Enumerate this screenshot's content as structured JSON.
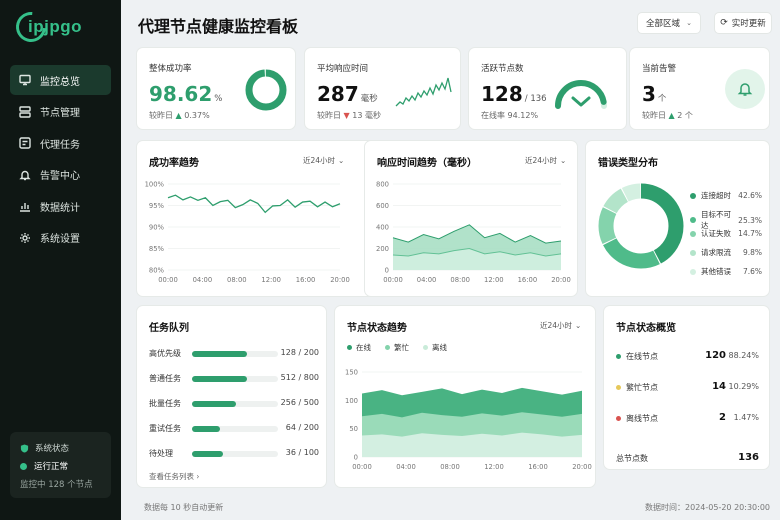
{
  "brand": {
    "logo_text": "ipjpgo"
  },
  "sidebar": {
    "items": [
      {
        "label": "监控总览",
        "icon": "monitor-icon",
        "active": true
      },
      {
        "label": "节点管理",
        "icon": "nodes-icon"
      },
      {
        "label": "代理任务",
        "icon": "task-icon"
      },
      {
        "label": "告警中心",
        "icon": "bell-icon"
      },
      {
        "label": "数据统计",
        "icon": "stats-icon"
      },
      {
        "label": "系统设置",
        "icon": "gear-icon"
      }
    ],
    "status": {
      "title": "系统状态",
      "state": "运行正常",
      "monitoring": "监控中 128 个节点"
    }
  },
  "header": {
    "title": "代理节点健康监控看板",
    "region": "全部区域",
    "refresh": "实时更新"
  },
  "kpis": {
    "success": {
      "title": "整体成功率",
      "value": "98.62",
      "unit": "%",
      "compare": "较昨日",
      "delta": "0.37%",
      "ring": 0.9862
    },
    "latency": {
      "title": "平均响应时间",
      "value": "287",
      "unit": "毫秒",
      "compare": "较昨日",
      "delta": "13 毫秒"
    },
    "active": {
      "title": "活跃节点数",
      "value": "128",
      "unit": "/ 136",
      "online": "在线率 94.12%",
      "gauge": 0.9412
    },
    "alerts": {
      "title": "当前告警",
      "value": "3",
      "unit": "个",
      "compare": "较昨日",
      "delta": "2 个"
    }
  },
  "charts": {
    "success_trend": {
      "title": "成功率趋势",
      "range": "近24小时",
      "yticks": [
        "100%",
        "95%",
        "90%",
        "85%",
        "80%"
      ],
      "xticks": [
        "00:00",
        "04:00",
        "08:00",
        "12:00",
        "16:00",
        "20:00"
      ]
    },
    "latency_trend": {
      "title": "响应时间趋势（毫秒）",
      "range": "近24小时",
      "yticks": [
        "800",
        "600",
        "400",
        "200",
        "0"
      ],
      "xticks": [
        "00:00",
        "04:00",
        "08:00",
        "12:00",
        "16:00",
        "20:00"
      ]
    },
    "error_dist": {
      "title": "错误类型分布"
    },
    "node_trend": {
      "title": "节点状态趋势",
      "range": "近24小时",
      "legend": [
        "在线",
        "繁忙",
        "离线"
      ],
      "yticks": [
        "150",
        "100",
        "50",
        "0"
      ],
      "xticks": [
        "00:00",
        "04:00",
        "08:00",
        "12:00",
        "16:00",
        "20:00"
      ]
    }
  },
  "chart_data": [
    {
      "type": "line",
      "title": "成功率趋势",
      "x": [
        "00:00",
        "01:00",
        "02:00",
        "03:00",
        "04:00",
        "05:00",
        "06:00",
        "07:00",
        "08:00",
        "09:00",
        "10:00",
        "11:00",
        "12:00",
        "13:00",
        "14:00",
        "15:00",
        "16:00",
        "17:00",
        "18:00",
        "19:00",
        "20:00",
        "21:00",
        "22:00",
        "23:00"
      ],
      "values": [
        96.8,
        97.4,
        96.3,
        97.0,
        96.2,
        96.8,
        95.0,
        95.9,
        96.2,
        94.5,
        95.2,
        96.3,
        95.5,
        93.4,
        94.9,
        95.0,
        96.3,
        94.6,
        95.8,
        96.0,
        94.7,
        95.8,
        94.7,
        95.4
      ],
      "ylim": [
        80,
        100
      ]
    },
    {
      "type": "area",
      "title": "响应时间趋势（毫秒）",
      "x": [
        "00:00",
        "02:00",
        "04:00",
        "06:00",
        "08:00",
        "10:00",
        "12:00",
        "14:00",
        "16:00",
        "18:00",
        "20:00",
        "22:00"
      ],
      "series": [
        {
          "values": [
            300,
            260,
            330,
            290,
            360,
            420,
            300,
            340,
            260,
            320,
            250,
            270
          ]
        },
        {
          "values": [
            140,
            130,
            160,
            150,
            180,
            200,
            150,
            170,
            140,
            160,
            130,
            150
          ]
        }
      ],
      "ylim": [
        0,
        800
      ]
    },
    {
      "type": "pie",
      "title": "错误类型分布",
      "labels": [
        "连接超时",
        "目标不可达",
        "认证失败",
        "请求限流",
        "其他错误"
      ],
      "values": [
        42.6,
        25.3,
        14.7,
        9.8,
        7.6
      ],
      "colors": [
        "#2e9e6d",
        "#4fbb8a",
        "#84d3ac",
        "#b3e4ca",
        "#d4f0e1"
      ]
    },
    {
      "type": "area",
      "title": "节点状态趋势",
      "x": [
        "00:00",
        "02:00",
        "04:00",
        "06:00",
        "08:00",
        "10:00",
        "12:00",
        "14:00",
        "16:00",
        "18:00",
        "20:00",
        "22:00"
      ],
      "series": [
        {
          "name": "在线",
          "values": [
            112,
            118,
            109,
            115,
            121,
            111,
            119,
            113,
            122,
            116,
            110,
            117
          ]
        },
        {
          "name": "繁忙",
          "values": [
            72,
            76,
            70,
            78,
            74,
            71,
            77,
            73,
            79,
            75,
            71,
            76
          ]
        },
        {
          "name": "离线",
          "values": [
            38,
            40,
            36,
            42,
            39,
            37,
            41,
            38,
            43,
            40,
            36,
            39
          ]
        }
      ],
      "ylim": [
        0,
        150
      ]
    }
  ],
  "errors": [
    {
      "label": "连接超时",
      "pct": "42.6%",
      "color": "#2e9e6d"
    },
    {
      "label": "目标不可达",
      "pct": "25.3%",
      "color": "#4fbb8a"
    },
    {
      "label": "认证失败",
      "pct": "14.7%",
      "color": "#84d3ac"
    },
    {
      "label": "请求限流",
      "pct": "9.8%",
      "color": "#b3e4ca"
    },
    {
      "label": "其他错误",
      "pct": "7.6%",
      "color": "#d4f0e1"
    }
  ],
  "queue": {
    "title": "任务队列",
    "link": "查看任务列表 ›",
    "items": [
      {
        "label": "高优先级",
        "value": "128 / 200",
        "ratio": 0.64
      },
      {
        "label": "普通任务",
        "value": "512 / 800",
        "ratio": 0.64
      },
      {
        "label": "批量任务",
        "value": "256 / 500",
        "ratio": 0.512
      },
      {
        "label": "重试任务",
        "value": "64 / 200",
        "ratio": 0.32
      },
      {
        "label": "待处理",
        "value": "36 / 100",
        "ratio": 0.36
      }
    ]
  },
  "node_overview": {
    "title": "节点状态概览",
    "items": [
      {
        "label": "在线节点",
        "count": "120",
        "pct": "88.24%",
        "color": "#2e9e6d"
      },
      {
        "label": "繁忙节点",
        "count": "14",
        "pct": "10.29%",
        "color": "#e6c85a"
      },
      {
        "label": "离线节点",
        "count": "2",
        "pct": "1.47%",
        "color": "#d9534f"
      }
    ],
    "total_label": "总节点数",
    "total": "136"
  },
  "footer": {
    "left": "数据每 10 秒自动更新",
    "right": "数据时间：2024-05-20 20:30:00"
  }
}
